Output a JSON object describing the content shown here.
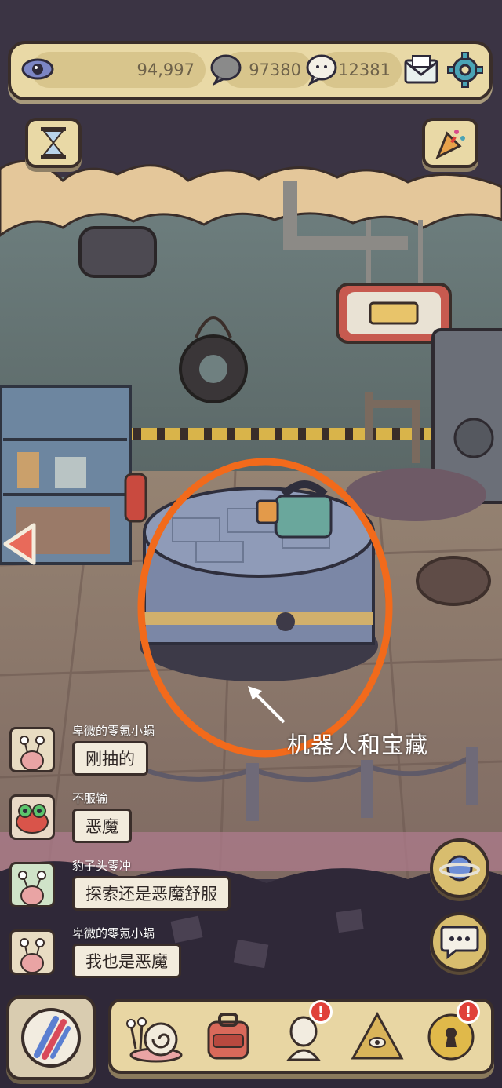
{
  "resources": {
    "eye_value": "94,997",
    "speech_gray_value": "97380",
    "speech_white_value": "12381"
  },
  "icons": {
    "eye": "eye-icon",
    "speech_gray": "speech-bubble-icon",
    "ghost": "ghost-speech-icon",
    "mail": "mail-icon",
    "settings": "gear-icon",
    "hourglass": "hourglass-icon",
    "party": "party-popper-icon",
    "back": "back-arrow-icon",
    "planet": "planet-icon",
    "chat": "chat-icon"
  },
  "annotation": {
    "label": "机器人和宝藏",
    "highlight_color": "#f26a1b"
  },
  "chat": [
    {
      "name": "卑微的零氪小蜗",
      "message": "刚抽的"
    },
    {
      "name": "不服输",
      "message": "恶魔"
    },
    {
      "name": "豹子头零冲",
      "message": "探索还是恶魔舒服"
    },
    {
      "name": "卑微的零氪小蜗",
      "message": "我也是恶魔"
    }
  ],
  "dock": {
    "items": [
      "snail",
      "backpack",
      "statue",
      "pyramid",
      "keyhole"
    ],
    "badges": [
      "!",
      "!"
    ]
  },
  "colors": {
    "panel": "#e9d9a6",
    "outline": "#3a2e2a",
    "badge": "#e0413a"
  }
}
